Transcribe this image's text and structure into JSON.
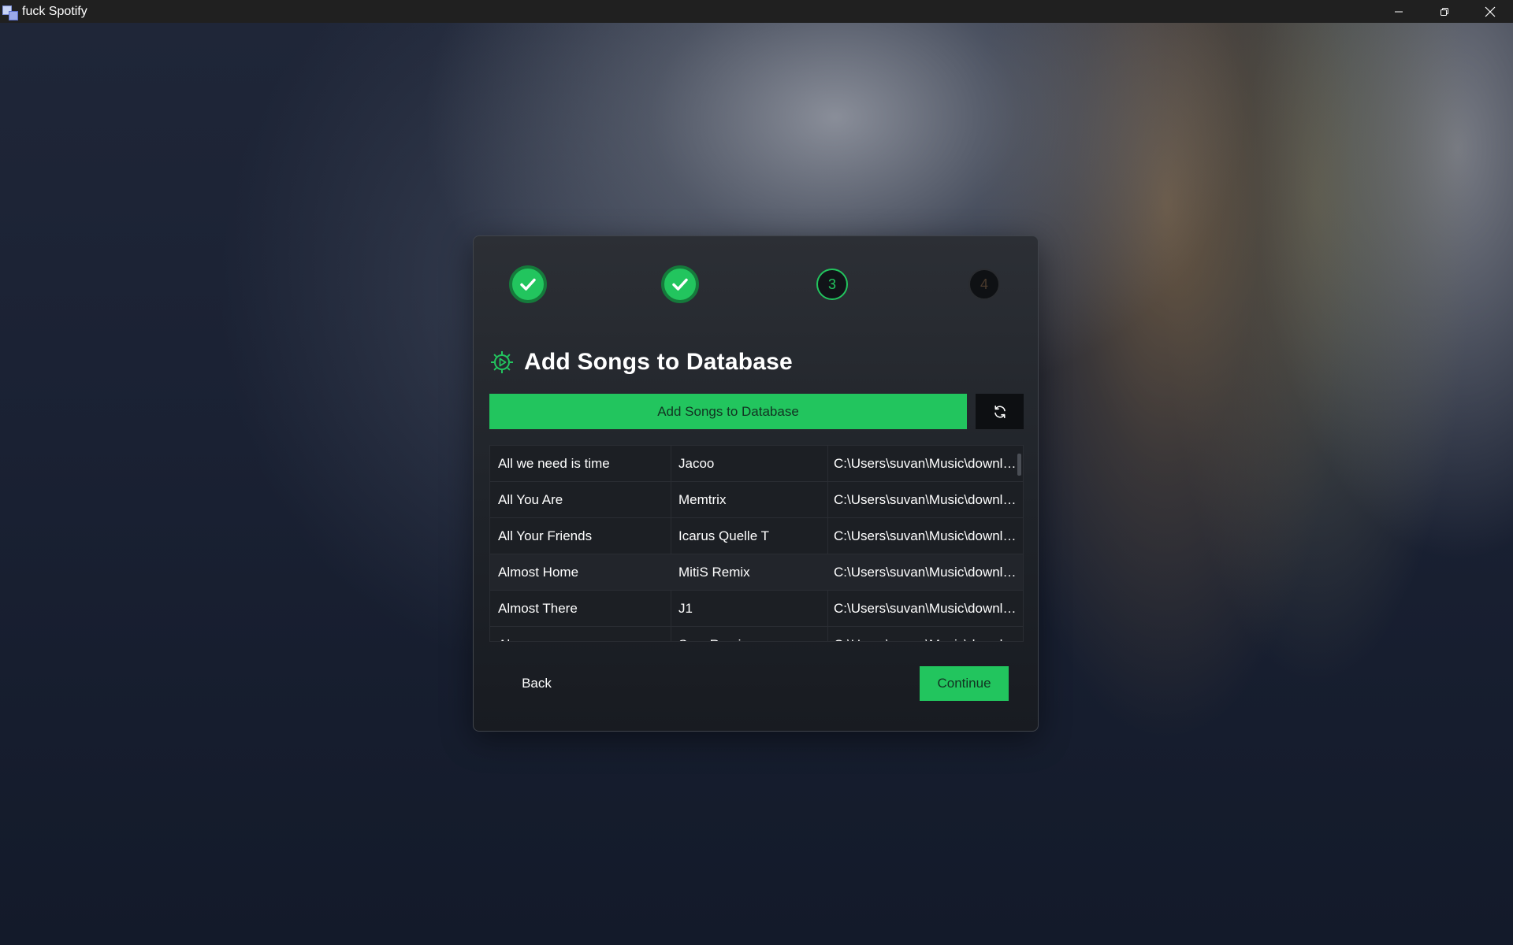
{
  "window": {
    "title": "fuck Spotify",
    "controls": [
      "minimize-icon",
      "restore-icon",
      "close-icon"
    ]
  },
  "stepper": {
    "steps": [
      {
        "label": "",
        "state": "done"
      },
      {
        "label": "",
        "state": "done"
      },
      {
        "label": "3",
        "state": "active"
      },
      {
        "label": "4",
        "state": "pending"
      }
    ]
  },
  "dialog": {
    "title": "Add Songs to Database",
    "icon": "gear-play-icon",
    "add_button_label": "Add Songs to Database",
    "refresh_icon": "refresh-icon",
    "back_label": "Back",
    "continue_label": "Continue"
  },
  "songs": {
    "rows": [
      {
        "title": "All we need is time",
        "artist": "Jacoo",
        "path": "C:\\Users\\suvan\\Music\\downloads"
      },
      {
        "title": "All You Are",
        "artist": "Memtrix",
        "path": "C:\\Users\\suvan\\Music\\downloads"
      },
      {
        "title": "All Your Friends",
        "artist": "Icarus Quelle T",
        "path": "C:\\Users\\suvan\\Music\\downloads"
      },
      {
        "title": "Almost Home",
        "artist": "MitiS Remix",
        "path": "C:\\Users\\suvan\\Music\\downloads"
      },
      {
        "title": "Almost There",
        "artist": "J1",
        "path": "C:\\Users\\suvan\\Music\\downloads"
      },
      {
        "title": "Alone",
        "artist": "Sam Remix",
        "path": "C:\\Users\\suvan\\Music\\downloads"
      }
    ]
  },
  "colors": {
    "accent": "#22c55e",
    "dialog_bg": "#1f2329",
    "titlebar_bg": "#202020"
  }
}
